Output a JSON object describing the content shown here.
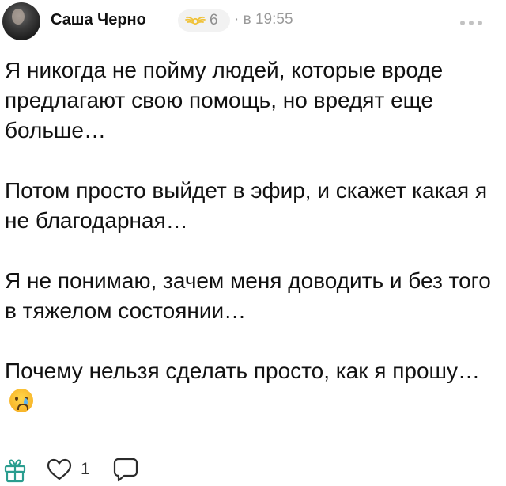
{
  "author": {
    "name": "Саша Черно",
    "badge_count": "6",
    "time": "· в 19:55"
  },
  "icons": {
    "avatar": "avatar",
    "badge": "wings-icon",
    "more": "more-dots-icon",
    "gift": "gift-icon",
    "like": "heart-icon",
    "comment": "comment-icon",
    "emoji": "crying-face-emoji"
  },
  "post": {
    "paragraphs": [
      "Я никогда не пойму людей, которые вроде предлагают свою помощь, но вредят еще больше…",
      "Потом просто выйдет в эфир, и скажет какая я не благодарная…",
      "Я не понимаю, зачем меня доводить и без того в тяжелом состоянии…",
      "Почему нельзя сделать просто, как я прошу…"
    ]
  },
  "actions": {
    "like_count": "1"
  },
  "colors": {
    "badge_wings": "#f0c23a",
    "muted_text": "#9a9a9a",
    "icon_stroke": "#2a9d8f"
  }
}
